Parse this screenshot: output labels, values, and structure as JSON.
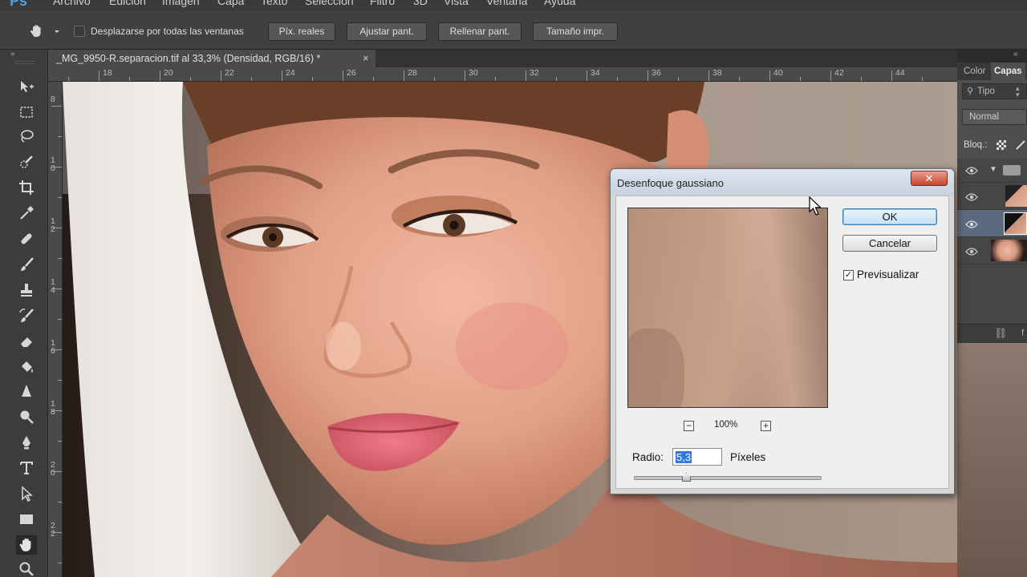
{
  "menubar": {
    "logo": "Ps",
    "items": [
      "Archivo",
      "Edición",
      "Imagen",
      "Capa",
      "Texto",
      "Selección",
      "Filtro",
      "3D",
      "Vista",
      "Ventana",
      "Ayuda"
    ]
  },
  "options_bar": {
    "checkbox_label": "Desplazarse por todas las ventanas",
    "buttons": [
      "Píx. reales",
      "Ajustar pant.",
      "Rellenar pant.",
      "Tamaño impr."
    ]
  },
  "document_tab": {
    "title": "_MG_9950-R.separacion.tif al 33,3% (Densidad, RGB/16) *",
    "close": "×"
  },
  "ruler": {
    "top_labels": [
      "18",
      "20",
      "22",
      "24",
      "26",
      "28",
      "30",
      "32",
      "34",
      "36",
      "38",
      "40",
      "42",
      "44"
    ],
    "left_labels": [
      "8",
      "1\n0",
      "1\n2",
      "1\n4",
      "1\n6",
      "1\n8",
      "2\n0",
      "2\n2"
    ]
  },
  "layers_panel": {
    "tabs": [
      "Color",
      "Capas"
    ],
    "filter": "Tipo",
    "blend_mode": "Normal",
    "lock_label": "Bloq.:"
  },
  "dialog": {
    "title": "Desenfoque gaussiano",
    "close": "✕",
    "ok": "OK",
    "cancel": "Cancelar",
    "preview_label": "Previsualizar",
    "preview_checked": true,
    "zoom": "100%",
    "radius_label": "Radio:",
    "radius_value": "5,3",
    "radius_unit": "Píxeles",
    "radius_slider_fraction": 0.28
  },
  "colors": {
    "accent": "#4ea3e6",
    "workspace": "#2b2b2b"
  }
}
